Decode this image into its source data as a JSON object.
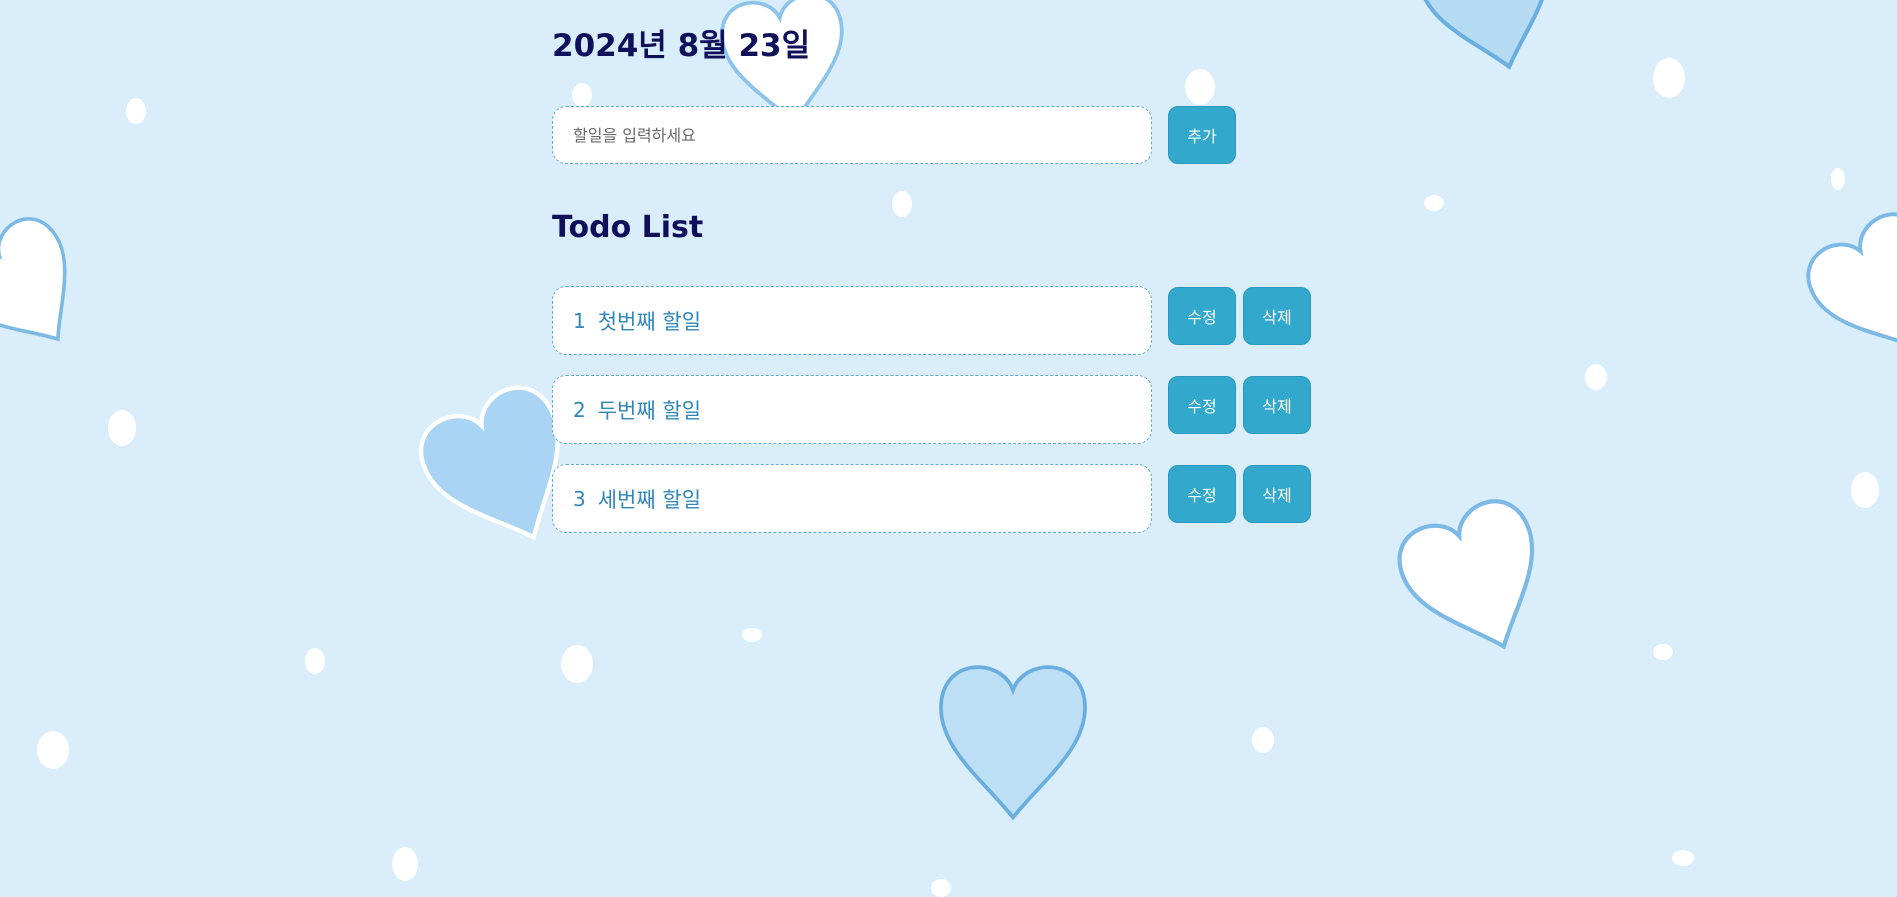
{
  "header": {
    "date": "2024년 8월 23일"
  },
  "add_form": {
    "placeholder": "할일을 입력하세요",
    "value": "",
    "add_label": "추가"
  },
  "list": {
    "title": "Todo List",
    "items": [
      {
        "num": "1",
        "text": "첫번째 할일",
        "edit_label": "수정",
        "delete_label": "삭제"
      },
      {
        "num": "2",
        "text": "두번째 할일",
        "edit_label": "수정",
        "delete_label": "삭제"
      },
      {
        "num": "3",
        "text": "세번째 할일",
        "edit_label": "수정",
        "delete_label": "삭제"
      }
    ]
  },
  "colors": {
    "background": "#d9eefa",
    "title": "#10105a",
    "button": "#31a8cc",
    "item_text": "#2f86b8",
    "heart_light": "#bcdff5",
    "heart_outline": "#76b4e0"
  },
  "decorations": {
    "icon": "heart-icon"
  }
}
